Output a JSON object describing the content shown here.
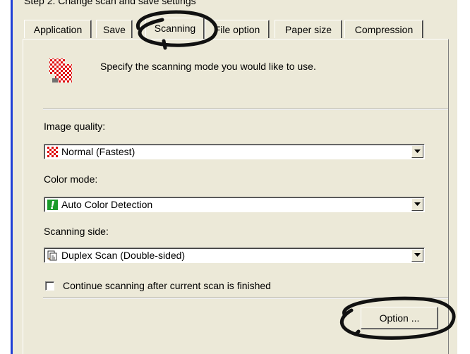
{
  "dialog": {
    "step_title": "Step 2. Change scan and save settings"
  },
  "tabs": [
    {
      "label": "Application",
      "active": false
    },
    {
      "label": "Save",
      "active": false
    },
    {
      "label": "Scanning",
      "active": true
    },
    {
      "label": "File option",
      "active": false
    },
    {
      "label": "Paper size",
      "active": false
    },
    {
      "label": "Compression",
      "active": false
    }
  ],
  "scanning": {
    "header_icon": "scan-mode-checker-icon",
    "header_text": "Specify the scanning mode you would like to use.",
    "image_quality": {
      "label": "Image quality:",
      "value": "Normal (Fastest)",
      "icon": "red-checker-icon"
    },
    "color_mode": {
      "label": "Color mode:",
      "value": "Auto Color Detection",
      "icon": "green-exclamation-icon"
    },
    "scanning_side": {
      "label": "Scanning side:",
      "value": "Duplex Scan (Double-sided)",
      "icon": "duplex-page-icon"
    },
    "continue_checkbox": {
      "label": "Continue scanning after current scan is finished",
      "checked": false
    },
    "option_button": "Option ..."
  },
  "colors": {
    "dialog_bg": "#ece9d8",
    "accent_rule": "#1f3fd6",
    "annotation": "#111111"
  }
}
